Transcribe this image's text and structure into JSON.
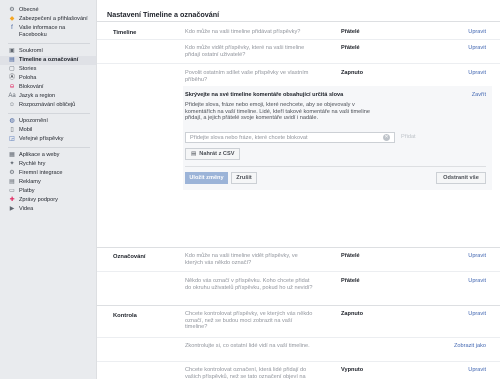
{
  "sidebar": {
    "items": [
      {
        "label": "Obecné",
        "icon": "gear-icon",
        "glyph": "⚙",
        "color": "#606770"
      },
      {
        "label": "Zabezpečení a přihlašování",
        "icon": "shield-icon",
        "glyph": "◆",
        "color": "#f5a623"
      },
      {
        "label": "Vaše informace na Facebooku",
        "icon": "facebook-icon",
        "glyph": "f",
        "color": "#3b5998"
      },
      {
        "label": "Soukromí",
        "icon": "privacy-icon",
        "glyph": "▣",
        "color": "#606770"
      },
      {
        "label": "Timeline a označování",
        "icon": "timeline-icon",
        "glyph": "▤",
        "color": "#3b5998"
      },
      {
        "label": "Stories",
        "icon": "stories-icon",
        "glyph": "▢",
        "color": "#606770"
      },
      {
        "label": "Poloha",
        "icon": "location-icon",
        "glyph": "Ⓐ",
        "color": "#1d2129"
      },
      {
        "label": "Blokování",
        "icon": "block-icon",
        "glyph": "⊖",
        "color": "#e0245e"
      },
      {
        "label": "Jazyk a region",
        "icon": "language-icon",
        "glyph": "Aa",
        "color": "#606770"
      },
      {
        "label": "Rozpoznávání obličejů",
        "icon": "face-recognition-icon",
        "glyph": "☺",
        "color": "#606770"
      },
      {
        "label": "Upozornění",
        "icon": "globe-icon",
        "glyph": "◍",
        "color": "#3b5998"
      },
      {
        "label": "Mobil",
        "icon": "mobile-icon",
        "glyph": "▯",
        "color": "#606770"
      },
      {
        "label": "Veřejné příspěvky",
        "icon": "rss-icon",
        "glyph": "◲",
        "color": "#4267b2"
      },
      {
        "label": "Aplikace a weby",
        "icon": "apps-icon",
        "glyph": "▦",
        "color": "#606770"
      },
      {
        "label": "Rychlé hry",
        "icon": "games-icon",
        "glyph": "✦",
        "color": "#606770"
      },
      {
        "label": "Firemní integrace",
        "icon": "business-icon",
        "glyph": "⚙",
        "color": "#606770"
      },
      {
        "label": "Reklamy",
        "icon": "ads-icon",
        "glyph": "▤",
        "color": "#606770"
      },
      {
        "label": "Platby",
        "icon": "payments-icon",
        "glyph": "▭",
        "color": "#606770"
      },
      {
        "label": "Zprávy podpory",
        "icon": "support-icon",
        "glyph": "✚",
        "color": "#e0245e"
      },
      {
        "label": "Videa",
        "icon": "video-icon",
        "glyph": "▶",
        "color": "#606770"
      }
    ]
  },
  "main": {
    "title": "Nastavení Timeline a označování",
    "timeline": {
      "section_title": "Timeline",
      "rows": [
        {
          "q": "Kdo může na vaši timeline přidávat příspěvky?",
          "v": "Přátelé",
          "act": "Upravit"
        },
        {
          "q": "Kdo může vidět příspěvky, které na vaši timeline přidají ostatní uživatelé?",
          "v": "Přátelé",
          "act": "Upravit"
        },
        {
          "q": "Povolit ostatním sdílet vaše příspěvky ve vlastním příběhu?",
          "v": "Zapnuto",
          "act": "Upravit"
        }
      ],
      "expanded": {
        "title": "Skrývejte na své timeline komentáře obsahující určitá slova",
        "close": "Zavřít",
        "desc": "Přidejte slova, fráze nebo emoji, které nechcete, aby se objevovaly v komentářích na vaší timeline. Lidé, kteří takové komentáře na vaši timeline přidají, a jejich přátelé svoje komentáře uvidí i nadále.",
        "placeholder": "Přidejte slova nebo fráze, které chcete blokovat",
        "add": "Přidat",
        "csv": "Nahrát z CSV",
        "save": "Uložit změny",
        "cancel": "Zrušit",
        "remove_all": "Odstranit vše"
      }
    },
    "tagging": {
      "section_title": "Označování",
      "rows": [
        {
          "q": "Kdo může na vaši timeline vidět příspěvky, ve kterých vás někdo označí?",
          "v": "Přátelé",
          "act": "Upravit"
        },
        {
          "q": "Někdo vás označí v příspěvku. Koho chcete přidat do okruhu uživatelů příspěvku, pokud ho už nevidí?",
          "v": "Přátelé",
          "act": "Upravit"
        }
      ]
    },
    "review": {
      "section_title": "Kontrola",
      "rows": [
        {
          "q": "Chcete kontrolovat příspěvky, ve kterých vás někdo označí, než se budou moci zobrazit na vaší timeline?",
          "v": "Zapnuto",
          "act": "Upravit"
        },
        {
          "q": "Zkontrolujte si, co ostatní lidé vidí na vaší timeline.",
          "v": "",
          "act": "Zobrazit jako"
        },
        {
          "q": "Chcete kontrolovat označení, která lidé přidají do vašich příspěvků, než se tato označení objeví na Facebooku?",
          "v": "Vypnuto",
          "act": "Upravit"
        }
      ]
    }
  },
  "colors": {
    "link": "#4267b2",
    "muted": "#90949c",
    "primary_disabled": "#9cb4d8"
  }
}
